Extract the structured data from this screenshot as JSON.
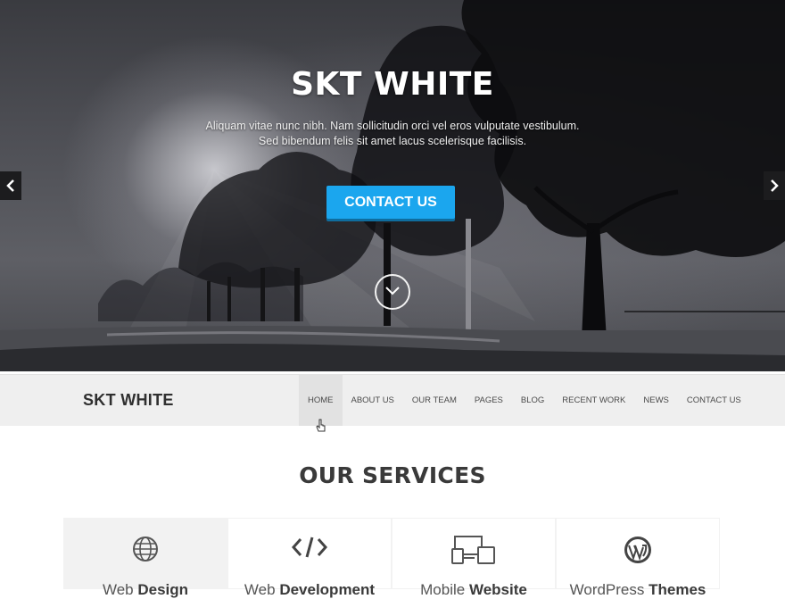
{
  "hero": {
    "title": "SKT WHITE",
    "subtitle_line1": "Aliquam vitae nunc nibh. Nam sollicitudin orci vel eros vulputate vestibulum.",
    "subtitle_line2": "Sed bibendum felis sit amet lacus scelerisque facilisis.",
    "cta_label": "CONTACT US",
    "prev_icon": "chevron-left-icon",
    "next_icon": "chevron-right-icon",
    "scroll_icon": "chevron-down-icon"
  },
  "nav": {
    "brand": "SKT WHITE",
    "items": [
      {
        "label": "HOME",
        "active": true
      },
      {
        "label": "ABOUT US"
      },
      {
        "label": "OUR TEAM"
      },
      {
        "label": "PAGES"
      },
      {
        "label": "BLOG"
      },
      {
        "label": "RECENT WORK"
      },
      {
        "label": "NEWS"
      },
      {
        "label": "CONTACT US"
      }
    ]
  },
  "services": {
    "title": "OUR SERVICES",
    "cards": [
      {
        "icon": "globe-icon",
        "title_light": "Web",
        "title_bold": "Design"
      },
      {
        "icon": "code-icon",
        "title_light": "Web",
        "title_bold": "Development"
      },
      {
        "icon": "devices-icon",
        "title_light": "Mobile",
        "title_bold": "Website"
      },
      {
        "icon": "wordpress-icon",
        "title_light": "WordPress",
        "title_bold": "Themes"
      }
    ]
  },
  "colors": {
    "accent": "#1ba6ee",
    "navbar_bg": "#efefef",
    "text_dark": "#3a3a3a"
  }
}
